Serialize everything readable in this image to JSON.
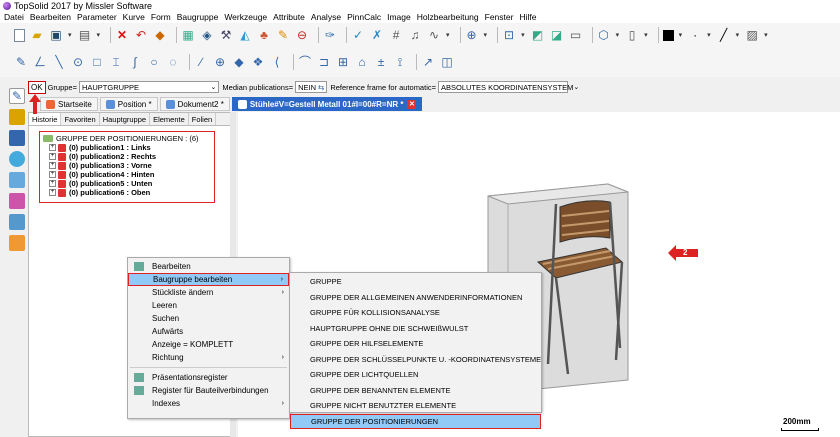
{
  "window": {
    "title": "TopSolid 2017 by Missler Software"
  },
  "menubar": {
    "items": [
      "Datei",
      "Bearbeiten",
      "Parameter",
      "Kurve",
      "Form",
      "Baugruppe",
      "Werkzeuge",
      "Attribute",
      "Analyse",
      "PinnCalc",
      "Image",
      "Holzbearbeitung",
      "Fenster",
      "Hilfe"
    ]
  },
  "gruppebar": {
    "ok_label": "OK",
    "gruppe_label": "Gruppe=",
    "gruppe_value": "HAUPTGRUPPE",
    "median_label": "Median publications=",
    "median_value": "NEIN",
    "reference_label": "Reference frame for automatic=",
    "reference_value": "ABSOLUTES KOORDINATENSYSTEM"
  },
  "tabs": [
    {
      "label": "Startseite"
    },
    {
      "label": "Position *"
    },
    {
      "label": "Dokument2 *"
    },
    {
      "label": "Stühle#V=Gestell Metall 01#I=00#R=NR *"
    }
  ],
  "panel_tabs": [
    "Historie",
    "Favoriten",
    "Hauptgruppe",
    "Elemente",
    "Folien"
  ],
  "tree": {
    "root": "GRUPPE DER POSITIONIERUNGEN : (6)",
    "children": [
      "(0) publication1 : Links",
      "(0) publication2 : Rechts",
      "(0) publication3 : Vorne",
      "(0) publication4 : Hinten",
      "(0) publication5 : Unten",
      "(0) publication6 : Oben"
    ]
  },
  "context_menu": {
    "items": [
      {
        "label": "Bearbeiten"
      },
      {
        "label": "Baugruppe bearbeiten"
      },
      {
        "label": "Stückliste ändern"
      },
      {
        "label": "Leeren"
      },
      {
        "label": "Suchen"
      },
      {
        "label": "Aufwärts"
      },
      {
        "label": "Anzeige = KOMPLETT"
      },
      {
        "label": "Richtung"
      },
      {
        "label": "Präsentationsregister"
      },
      {
        "label": "Register für Bauteilverbindungen"
      },
      {
        "label": "Indexes"
      }
    ]
  },
  "submenu": {
    "items": [
      "GRUPPE",
      "GRUPPE DER ALLGEMEINEN ANWENDERINFORMATIONEN",
      "GRUPPE FÜR KOLLISIONSANALYSE",
      "HAUPTGRUPPE OHNE DIE SCHWEIßWULST",
      "GRUPPE DER HILFSELEMENTE",
      "GRUPPE DER SCHLÜSSELPUNKTE U. -KOORDINATENSYSTEME",
      "GRUPPE DER LICHTQUELLEN",
      "GRUPPE DER BENANNTEN ELEMENTE",
      "GRUPPE NICHT BENUTZTER ELEMENTE",
      "GRUPPE DER POSITIONIERUNGEN"
    ]
  },
  "viewport": {
    "badge": "2",
    "scale": "200mm"
  },
  "colors": {
    "accent": "#2a67c6",
    "highlight": "#91c9f7",
    "annotation": "#dd2222"
  }
}
